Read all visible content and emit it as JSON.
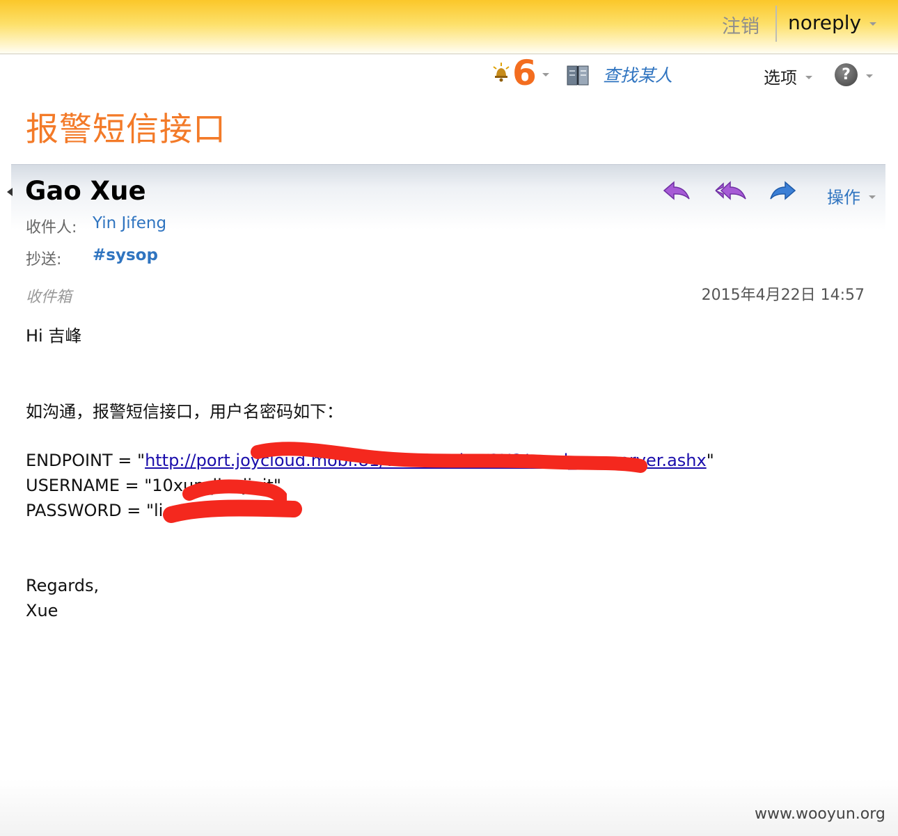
{
  "topbar": {
    "signout_label": "注销",
    "user_name": "noreply"
  },
  "toolbar": {
    "notification_count": "6",
    "find_person_label": "查找某人",
    "options_label": "选项",
    "help_label": "?"
  },
  "page": {
    "title": "报警短信接口"
  },
  "message": {
    "sender": "Gao Xue",
    "to_label": "收件人:",
    "to_value": "Yin Jifeng",
    "cc_label": "抄送:",
    "cc_value": "#sysop",
    "actions_label": "操作",
    "folder": "收件箱",
    "date": "2015年4月22日 14:57",
    "body": {
      "greeting": "Hi 吉峰",
      "intro": "如沟通，报警短信接口，用户名密码如下：",
      "endpoint_prefix": "ENDPOINT = \"",
      "endpoint_url": "http://port.joycloud.mobi:81/WebService/2U2/send_smsserver.ashx",
      "endpoint_suffix": "\"",
      "username_line": "USERNAME = \"10xun_lianjiait\"",
      "password_line": "PASSWORD = \"li              \"",
      "regards": "Regards,",
      "signature": "Xue"
    }
  },
  "watermark": "www.wooyun.org",
  "icons": {
    "notification": "bell-icon",
    "address_book": "address-book-icon",
    "reply": "reply-icon",
    "reply_all": "reply-all-icon",
    "forward": "forward-icon",
    "help": "help-icon"
  },
  "colors": {
    "accent_orange": "#f37a28",
    "link_blue": "#2f74c0",
    "redaction_red": "#f4281e",
    "reply_purple": "#a65bd6",
    "forward_blue": "#3b7fd6"
  }
}
